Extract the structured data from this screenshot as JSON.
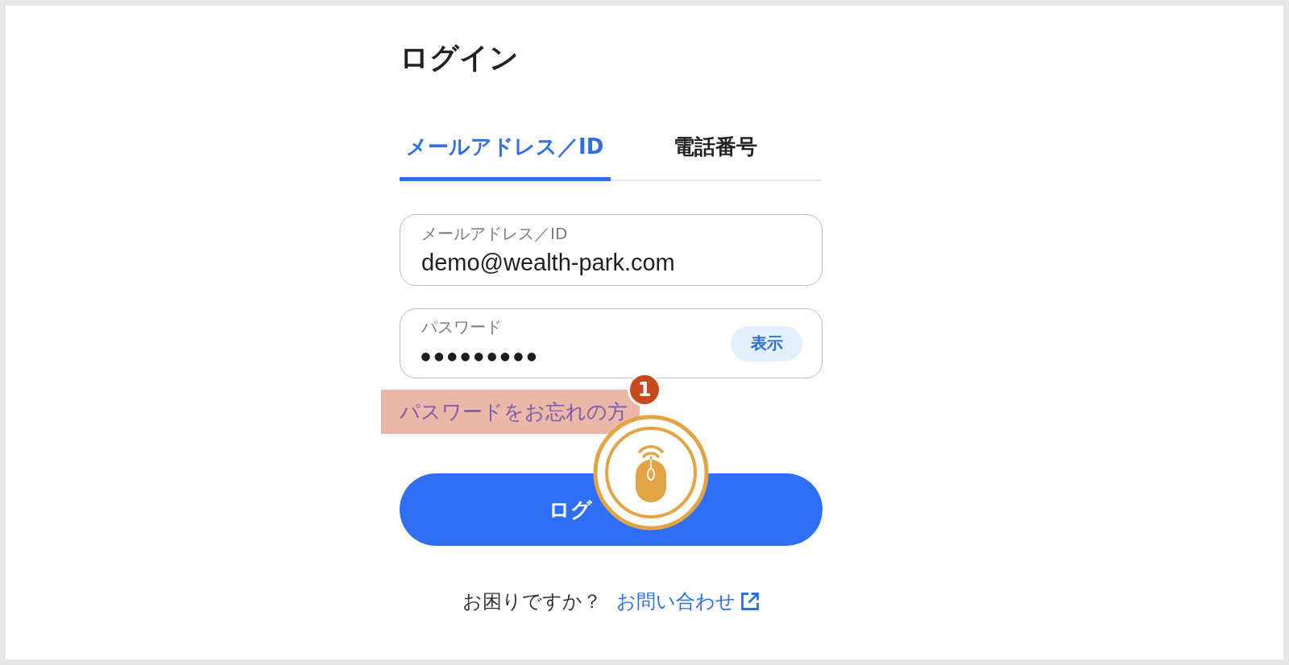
{
  "title": "ログイン",
  "tabs": [
    {
      "label": "メールアドレス／ID",
      "selected": true
    },
    {
      "label": "電話番号",
      "selected": false
    }
  ],
  "fields": [
    {
      "kind": "text",
      "label": "メールアドレス／ID",
      "value": "demo@wealth-park.com"
    },
    {
      "kind": "password",
      "label": "パスワード",
      "value": "●●●●●●●●●",
      "toggle_button": "表示"
    }
  ],
  "forgot_password": {
    "label": "パスワードをお忘れの方",
    "highlighted": true
  },
  "login_button": "ログ",
  "help": {
    "text": "お困りですか？",
    "link": "お問い合わせ"
  },
  "step_badge": "1"
}
